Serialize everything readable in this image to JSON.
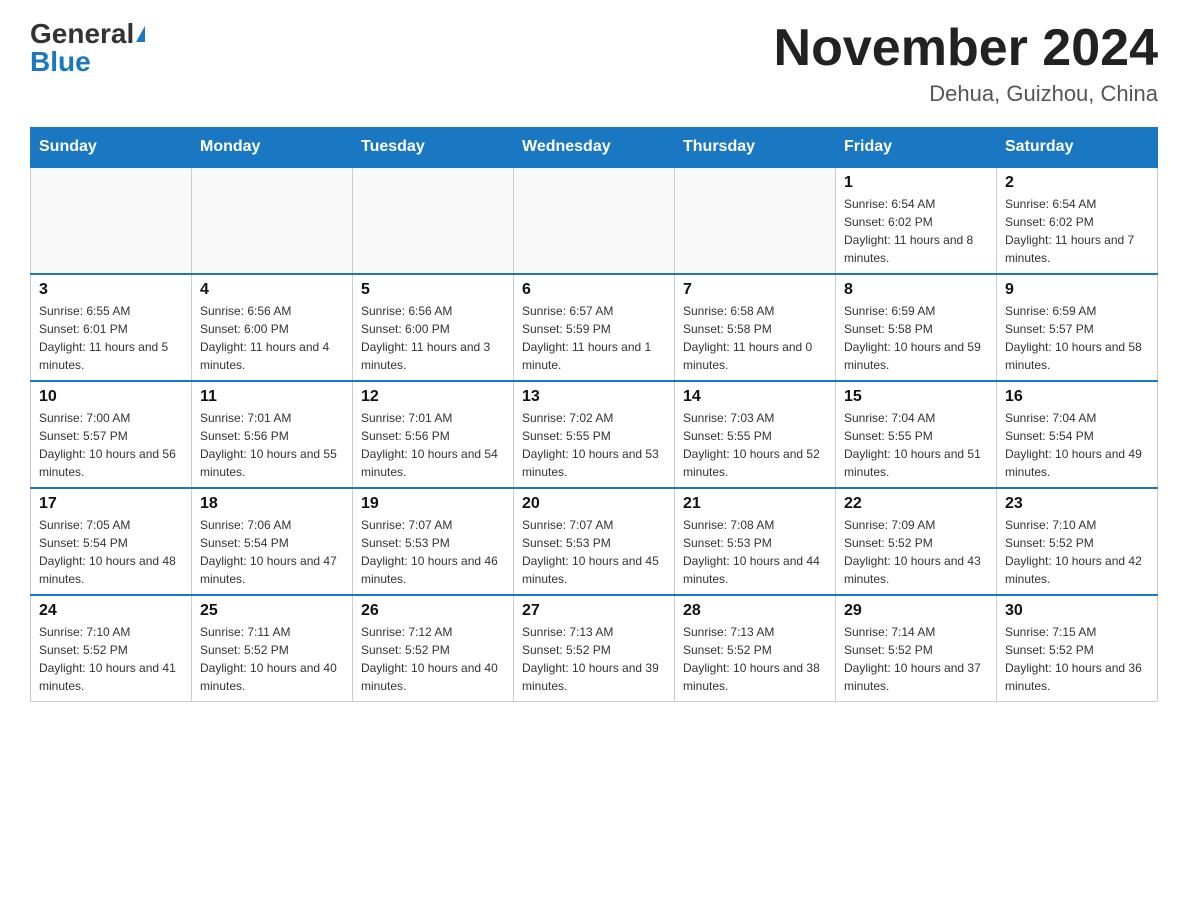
{
  "header": {
    "logo_general": "General",
    "logo_blue": "Blue",
    "month_title": "November 2024",
    "location": "Dehua, Guizhou, China"
  },
  "days_of_week": [
    "Sunday",
    "Monday",
    "Tuesday",
    "Wednesday",
    "Thursday",
    "Friday",
    "Saturday"
  ],
  "weeks": [
    {
      "days": [
        {
          "number": "",
          "info": ""
        },
        {
          "number": "",
          "info": ""
        },
        {
          "number": "",
          "info": ""
        },
        {
          "number": "",
          "info": ""
        },
        {
          "number": "",
          "info": ""
        },
        {
          "number": "1",
          "info": "Sunrise: 6:54 AM\nSunset: 6:02 PM\nDaylight: 11 hours and 8 minutes."
        },
        {
          "number": "2",
          "info": "Sunrise: 6:54 AM\nSunset: 6:02 PM\nDaylight: 11 hours and 7 minutes."
        }
      ]
    },
    {
      "days": [
        {
          "number": "3",
          "info": "Sunrise: 6:55 AM\nSunset: 6:01 PM\nDaylight: 11 hours and 5 minutes."
        },
        {
          "number": "4",
          "info": "Sunrise: 6:56 AM\nSunset: 6:00 PM\nDaylight: 11 hours and 4 minutes."
        },
        {
          "number": "5",
          "info": "Sunrise: 6:56 AM\nSunset: 6:00 PM\nDaylight: 11 hours and 3 minutes."
        },
        {
          "number": "6",
          "info": "Sunrise: 6:57 AM\nSunset: 5:59 PM\nDaylight: 11 hours and 1 minute."
        },
        {
          "number": "7",
          "info": "Sunrise: 6:58 AM\nSunset: 5:58 PM\nDaylight: 11 hours and 0 minutes."
        },
        {
          "number": "8",
          "info": "Sunrise: 6:59 AM\nSunset: 5:58 PM\nDaylight: 10 hours and 59 minutes."
        },
        {
          "number": "9",
          "info": "Sunrise: 6:59 AM\nSunset: 5:57 PM\nDaylight: 10 hours and 58 minutes."
        }
      ]
    },
    {
      "days": [
        {
          "number": "10",
          "info": "Sunrise: 7:00 AM\nSunset: 5:57 PM\nDaylight: 10 hours and 56 minutes."
        },
        {
          "number": "11",
          "info": "Sunrise: 7:01 AM\nSunset: 5:56 PM\nDaylight: 10 hours and 55 minutes."
        },
        {
          "number": "12",
          "info": "Sunrise: 7:01 AM\nSunset: 5:56 PM\nDaylight: 10 hours and 54 minutes."
        },
        {
          "number": "13",
          "info": "Sunrise: 7:02 AM\nSunset: 5:55 PM\nDaylight: 10 hours and 53 minutes."
        },
        {
          "number": "14",
          "info": "Sunrise: 7:03 AM\nSunset: 5:55 PM\nDaylight: 10 hours and 52 minutes."
        },
        {
          "number": "15",
          "info": "Sunrise: 7:04 AM\nSunset: 5:55 PM\nDaylight: 10 hours and 51 minutes."
        },
        {
          "number": "16",
          "info": "Sunrise: 7:04 AM\nSunset: 5:54 PM\nDaylight: 10 hours and 49 minutes."
        }
      ]
    },
    {
      "days": [
        {
          "number": "17",
          "info": "Sunrise: 7:05 AM\nSunset: 5:54 PM\nDaylight: 10 hours and 48 minutes."
        },
        {
          "number": "18",
          "info": "Sunrise: 7:06 AM\nSunset: 5:54 PM\nDaylight: 10 hours and 47 minutes."
        },
        {
          "number": "19",
          "info": "Sunrise: 7:07 AM\nSunset: 5:53 PM\nDaylight: 10 hours and 46 minutes."
        },
        {
          "number": "20",
          "info": "Sunrise: 7:07 AM\nSunset: 5:53 PM\nDaylight: 10 hours and 45 minutes."
        },
        {
          "number": "21",
          "info": "Sunrise: 7:08 AM\nSunset: 5:53 PM\nDaylight: 10 hours and 44 minutes."
        },
        {
          "number": "22",
          "info": "Sunrise: 7:09 AM\nSunset: 5:52 PM\nDaylight: 10 hours and 43 minutes."
        },
        {
          "number": "23",
          "info": "Sunrise: 7:10 AM\nSunset: 5:52 PM\nDaylight: 10 hours and 42 minutes."
        }
      ]
    },
    {
      "days": [
        {
          "number": "24",
          "info": "Sunrise: 7:10 AM\nSunset: 5:52 PM\nDaylight: 10 hours and 41 minutes."
        },
        {
          "number": "25",
          "info": "Sunrise: 7:11 AM\nSunset: 5:52 PM\nDaylight: 10 hours and 40 minutes."
        },
        {
          "number": "26",
          "info": "Sunrise: 7:12 AM\nSunset: 5:52 PM\nDaylight: 10 hours and 40 minutes."
        },
        {
          "number": "27",
          "info": "Sunrise: 7:13 AM\nSunset: 5:52 PM\nDaylight: 10 hours and 39 minutes."
        },
        {
          "number": "28",
          "info": "Sunrise: 7:13 AM\nSunset: 5:52 PM\nDaylight: 10 hours and 38 minutes."
        },
        {
          "number": "29",
          "info": "Sunrise: 7:14 AM\nSunset: 5:52 PM\nDaylight: 10 hours and 37 minutes."
        },
        {
          "number": "30",
          "info": "Sunrise: 7:15 AM\nSunset: 5:52 PM\nDaylight: 10 hours and 36 minutes."
        }
      ]
    }
  ]
}
